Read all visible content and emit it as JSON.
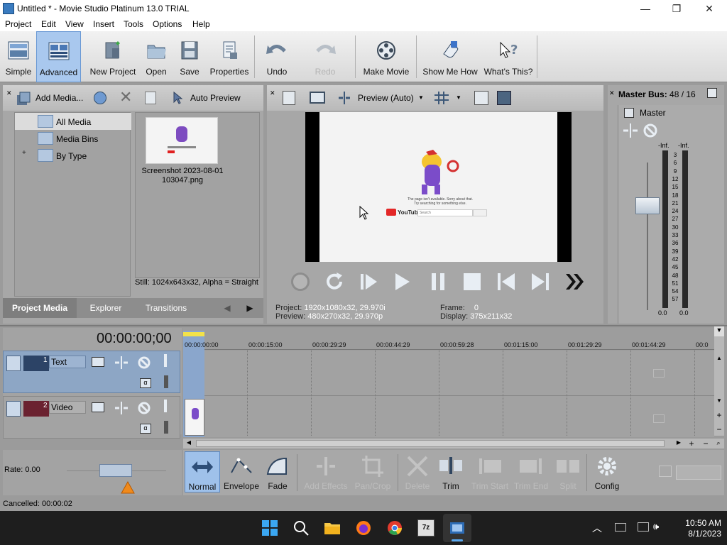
{
  "window": {
    "title": "Untitled * - Movie Studio Platinum 13.0 TRIAL",
    "minimize": "—",
    "maximize": "❐",
    "close": "✕"
  },
  "menu": [
    "Project",
    "Edit",
    "View",
    "Insert",
    "Tools",
    "Options",
    "Help"
  ],
  "toolbar": {
    "simple": "Simple",
    "advanced": "Advanced",
    "new_project": "New Project",
    "open": "Open",
    "save": "Save",
    "properties": "Properties",
    "undo": "Undo",
    "redo": "Redo",
    "make_movie": "Make Movie",
    "show_me_how": "Show Me How",
    "whats_this": "What's This?"
  },
  "media": {
    "add_media": "Add Media...",
    "auto_preview": "Auto Preview",
    "tree": [
      "All Media",
      "Media Bins",
      "By Type"
    ],
    "tree_expander": "+",
    "thumb_caption": "Screenshot 2023-08-01 103047.png",
    "thumb_name_line1": "Screenshot 2023-08-01",
    "thumb_name_line2": "103047.png",
    "still_info": "Still: 1024x643x32, Alpha = Straight",
    "tabs": [
      "Project Media",
      "Explorer",
      "Transitions"
    ]
  },
  "preview": {
    "mode": "Preview (Auto)",
    "project_label": "Project:",
    "project_value": "1920x1080x32, 29.970i",
    "preview_label": "Preview:",
    "preview_value": "480x270x32, 29.970p",
    "frame_label": "Frame:",
    "frame_value": "0",
    "display_label": "Display:",
    "display_value": "375x211x32",
    "frame_text_line1": "The page isn't available. Sorry about that.",
    "frame_text_line2": "Try searching for something else.",
    "youtube": "YouTube",
    "search": "Search"
  },
  "master": {
    "title": "Master Bus:",
    "value": "48 / 16",
    "label": "Master",
    "peak_left": "-Inf.",
    "peak_right": "-Inf.",
    "scale": [
      "3",
      "6",
      "9",
      "12",
      "15",
      "18",
      "21",
      "24",
      "27",
      "30",
      "33",
      "36",
      "39",
      "42",
      "45",
      "48",
      "51",
      "54",
      "57"
    ],
    "bottom_left": "0.0",
    "bottom_right": "0.0"
  },
  "timeline": {
    "timecode": "00:00:00;00",
    "ruler": [
      "00:00:00:00",
      "00:00:15:00",
      "00:00:29:29",
      "00:00:44:29",
      "00:00:59:28",
      "00:01:15:00",
      "00:01:29:29",
      "00:01:44:29",
      "00:0"
    ],
    "tracks": [
      {
        "num": "1",
        "name": "Text"
      },
      {
        "num": "2",
        "name": "Video"
      }
    ],
    "rate": "Rate: 0.00",
    "status": "Cancelled: 00:00:02"
  },
  "edit_tools": {
    "normal": "Normal",
    "envelope": "Envelope",
    "fade": "Fade",
    "add_effects": "Add Effects",
    "pan_crop": "Pan/Crop",
    "delete": "Delete",
    "trim": "Trim",
    "trim_start": "Trim Start",
    "trim_end": "Trim End",
    "split": "Split",
    "config": "Config"
  },
  "taskbar": {
    "time": "10:50 AM",
    "date": "8/1/2023",
    "zip_label": "7z"
  },
  "colors": {
    "accent": "#3d74c9",
    "selected_tool": "#9fc1ea",
    "panel": "#a7a7a7",
    "track_header": "#8fa9c9"
  }
}
